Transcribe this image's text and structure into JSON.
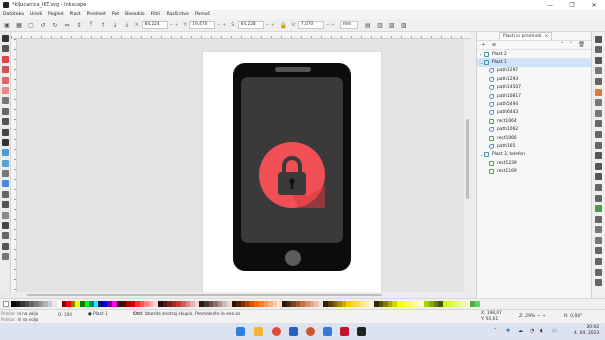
{
  "window": {
    "title": "*kljucanica_IKT.svg - Inkscape",
    "controls": [
      "—",
      "❐",
      "✕"
    ]
  },
  "menu": [
    "Datoteka",
    "Uredi",
    "Pogled",
    "Plast",
    "Predmet",
    "Pot",
    "Besedilo",
    "Filtri",
    "Razširitve",
    "Pomoč"
  ],
  "toolbar": {
    "x_label": "X:",
    "x_value": "84,224",
    "y_label": "Y:",
    "y_value": "19,470",
    "w_label": "Š:",
    "w_value": "64,228",
    "h_label": "V:",
    "h_value": "7,070",
    "unit": "mm"
  },
  "layers_panel": {
    "tab_label": "Plasti in predmeti",
    "rows": [
      {
        "label": "Plast 2",
        "kind": "layer",
        "expanded": false,
        "selected": false,
        "indent": 0
      },
      {
        "label": "Plast 1",
        "kind": "layer",
        "expanded": true,
        "selected": true,
        "indent": 0
      },
      {
        "label": "path1297",
        "kind": "path",
        "indent": 1
      },
      {
        "label": "path1293",
        "kind": "path",
        "indent": 1
      },
      {
        "label": "path14507",
        "kind": "path",
        "indent": 1
      },
      {
        "label": "path10817",
        "kind": "path",
        "indent": 1
      },
      {
        "label": "path5494",
        "kind": "path",
        "indent": 1
      },
      {
        "label": "path6443",
        "kind": "path",
        "indent": 1
      },
      {
        "label": "rect1064",
        "kind": "rect",
        "indent": 1
      },
      {
        "label": "path1062",
        "kind": "path",
        "indent": 1
      },
      {
        "label": "rect1066",
        "kind": "rect",
        "indent": 1
      },
      {
        "label": "path165",
        "kind": "path",
        "indent": 1
      },
      {
        "label": "Plast 3, telefon",
        "kind": "layer",
        "expanded": true,
        "selected": false,
        "indent": 0
      },
      {
        "label": "rect1239",
        "kind": "rect",
        "indent": 1
      },
      {
        "label": "rect1169",
        "kind": "rect",
        "indent": 1
      }
    ]
  },
  "status": {
    "fill_label": "Polnilo:",
    "fill_value": "ni na voljo",
    "stroke_label": "Poteza:",
    "stroke_value": "ni na voljo",
    "opacity_label": "O:",
    "opacity_value": "100",
    "layer_label": "Plast 1",
    "message_bold": "Ctrl",
    "message_text": ": Izberite znotraj skupin. Premaknite le eno os",
    "x_label": "X:",
    "x_value": "198,07",
    "y_label": "Y:",
    "y_value": "91,61",
    "zoom_label": "Z:",
    "zoom_value": "29%",
    "rot_label": "R:",
    "rot_value": "0,00°"
  },
  "clock": {
    "time": "20:02",
    "date": "4. 04. 2023"
  },
  "colors": {
    "lock_circle": "#f14f56",
    "phone_body": "#0c0c0c",
    "screen": "#3a3a3a",
    "selection": "#cfe2f7"
  }
}
